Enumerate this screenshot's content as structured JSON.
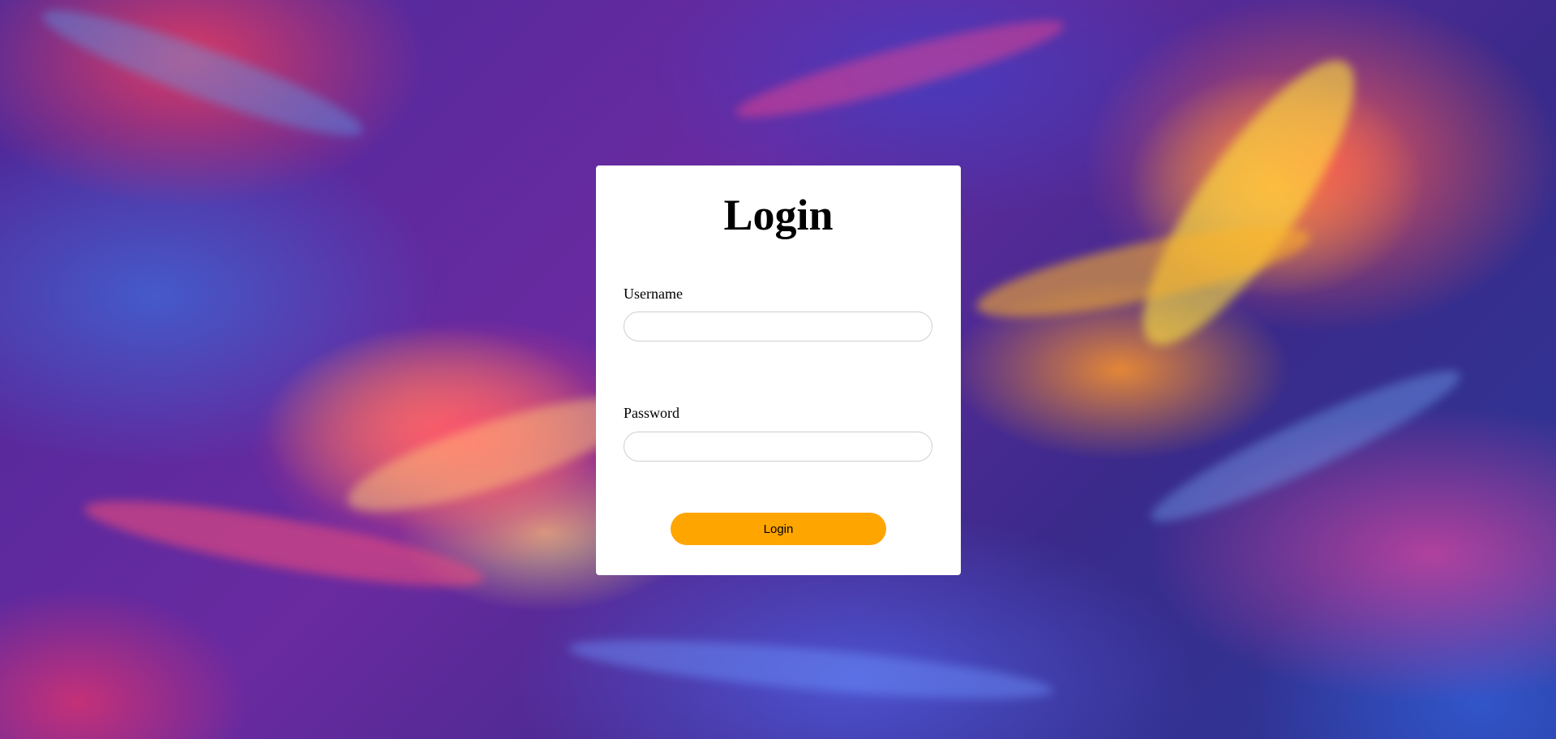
{
  "login": {
    "title": "Login",
    "username_label": "Username",
    "username_value": "",
    "password_label": "Password",
    "password_value": "",
    "submit_label": "Login"
  },
  "colors": {
    "card_background": "#ffffff",
    "button_background": "#ffa500",
    "input_border": "#cfcfcf"
  }
}
